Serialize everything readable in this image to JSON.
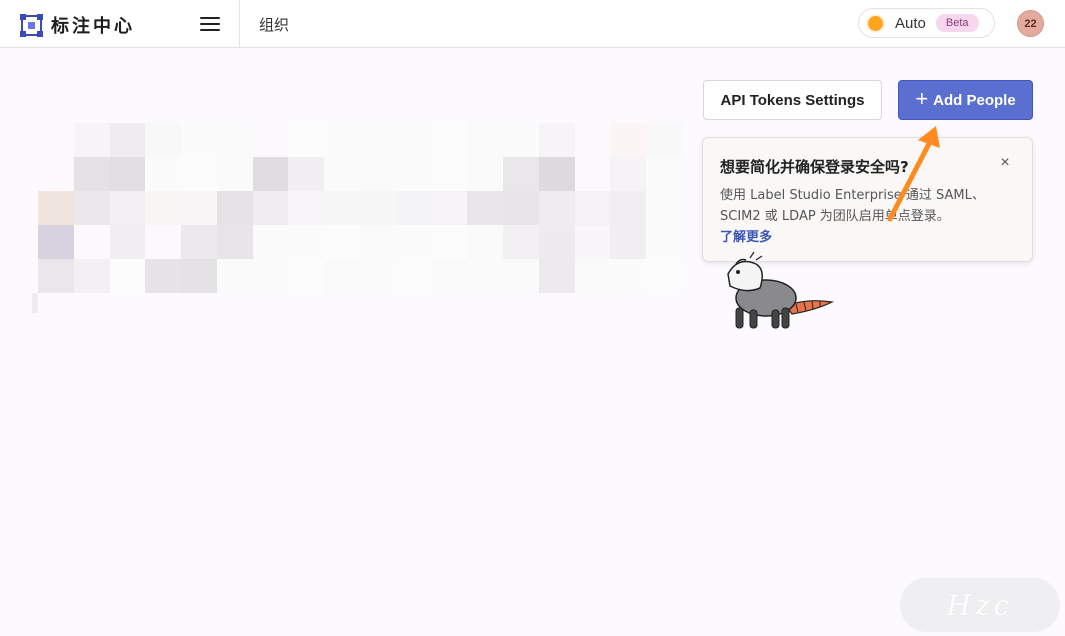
{
  "app": {
    "logo_text": "标注中心",
    "breadcrumb": "组织"
  },
  "header": {
    "theme": {
      "label": "Auto",
      "badge": "Beta"
    },
    "avatar_initials": "22"
  },
  "actions": {
    "tokens_label": "API Tokens Settings",
    "add_label": "Add People",
    "add_icon": "plus-icon"
  },
  "popover": {
    "title": "想要简化并确保登录安全吗?",
    "body": "使用 Label Studio Enterprise 通过 SAML、SCIM2 或 LDAP 为团队启用单点登录。",
    "link": "了解更多",
    "close": "×"
  },
  "watermark": "Hzc",
  "colors": {
    "primary": "#5a6fcf",
    "theme_dot": "#ffa51f",
    "link": "#3c55b8",
    "arrow": "#ff8a1f"
  }
}
